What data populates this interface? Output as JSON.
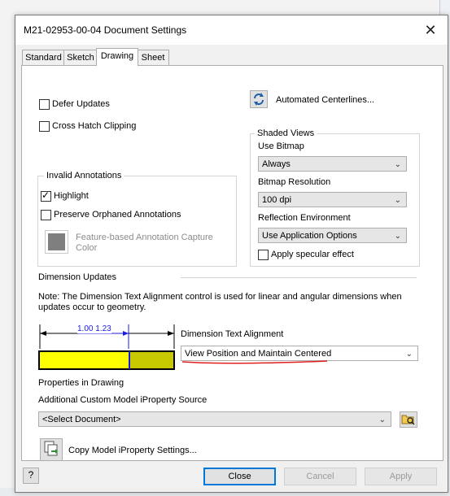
{
  "window": {
    "title": "M21-02953-00-04 Document Settings",
    "close_symbol": "✕"
  },
  "tabs": [
    {
      "label": "Standard",
      "active": false
    },
    {
      "label": "Sketch",
      "active": false
    },
    {
      "label": "Drawing",
      "active": true
    },
    {
      "label": "Sheet",
      "active": false
    }
  ],
  "options": {
    "defer_updates": {
      "label": "Defer Updates",
      "checked": false
    },
    "cross_hatch_clipping": {
      "label": "Cross Hatch Clipping",
      "checked": false
    },
    "automated_centerlines": {
      "label": "Automated Centerlines..."
    }
  },
  "invalid_annotations": {
    "title": "Invalid Annotations",
    "highlight": {
      "label": "Highlight",
      "checked": true
    },
    "preserve_orphaned": {
      "label": "Preserve Orphaned Annotations",
      "checked": false
    },
    "capture_color": {
      "label_line1": "Feature-based Annotation Capture",
      "label_line2": "Color",
      "color": "#7f7f7f"
    }
  },
  "shaded_views": {
    "title": "Shaded Views",
    "use_bitmap_label": "Use Bitmap",
    "use_bitmap_value": "Always",
    "bitmap_resolution_label": "Bitmap Resolution",
    "bitmap_resolution_value": "100 dpi",
    "reflection_label": "Reflection Environment",
    "reflection_value": "Use Application Options",
    "specular": {
      "label": "Apply specular effect",
      "checked": false
    }
  },
  "dimension_updates": {
    "title": "Dimension Updates",
    "note_line1": "Note: The Dimension Text Alignment control is used for linear and angular dimensions when",
    "note_line2": "updates occur to geometry.",
    "preview_text": "1.00 1.23",
    "alignment_label": "Dimension Text Alignment",
    "alignment_value": "View Position and Maintain Centered",
    "colors": {
      "bar": "#ffff00",
      "bar_right": "#c8c800",
      "dim_text": "#1a1ae6",
      "underline": "#e02020"
    }
  },
  "properties": {
    "title": "Properties in Drawing",
    "source_label": "Additional Custom Model iProperty Source",
    "source_value": "<Select Document>",
    "copy_button": "Copy Model iProperty Settings..."
  },
  "footer": {
    "help_icon": "?",
    "close": "Close",
    "cancel": "Cancel",
    "apply": "Apply"
  }
}
